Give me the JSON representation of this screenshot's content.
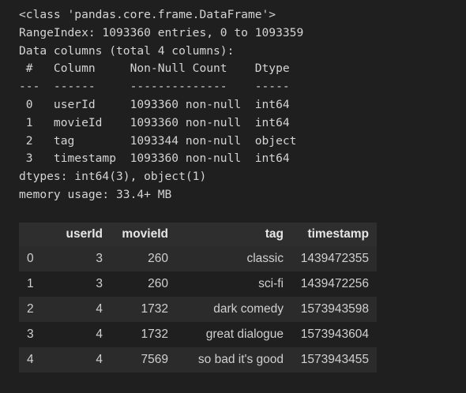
{
  "info": {
    "lines": [
      "<class 'pandas.core.frame.DataFrame'>",
      "RangeIndex: 1093360 entries, 0 to 1093359",
      "Data columns (total 4 columns):",
      " #   Column     Non-Null Count    Dtype",
      "---  ------     --------------    -----",
      " 0   userId     1093360 non-null  int64",
      " 1   movieId    1093360 non-null  int64",
      " 2   tag        1093344 non-null  object",
      " 3   timestamp  1093360 non-null  int64",
      "dtypes: int64(3), object(1)",
      "memory usage: 33.4+ MB"
    ]
  },
  "table": {
    "columns": [
      "",
      "userId",
      "movieId",
      "tag",
      "timestamp"
    ],
    "rows": [
      [
        "0",
        "3",
        "260",
        "classic",
        "1439472355"
      ],
      [
        "1",
        "3",
        "260",
        "sci-fi",
        "1439472256"
      ],
      [
        "2",
        "4",
        "1732",
        "dark comedy",
        "1573943598"
      ],
      [
        "3",
        "4",
        "1732",
        "great dialogue",
        "1573943604"
      ],
      [
        "4",
        "4",
        "7569",
        "so bad it's good",
        "1573943455"
      ]
    ]
  }
}
